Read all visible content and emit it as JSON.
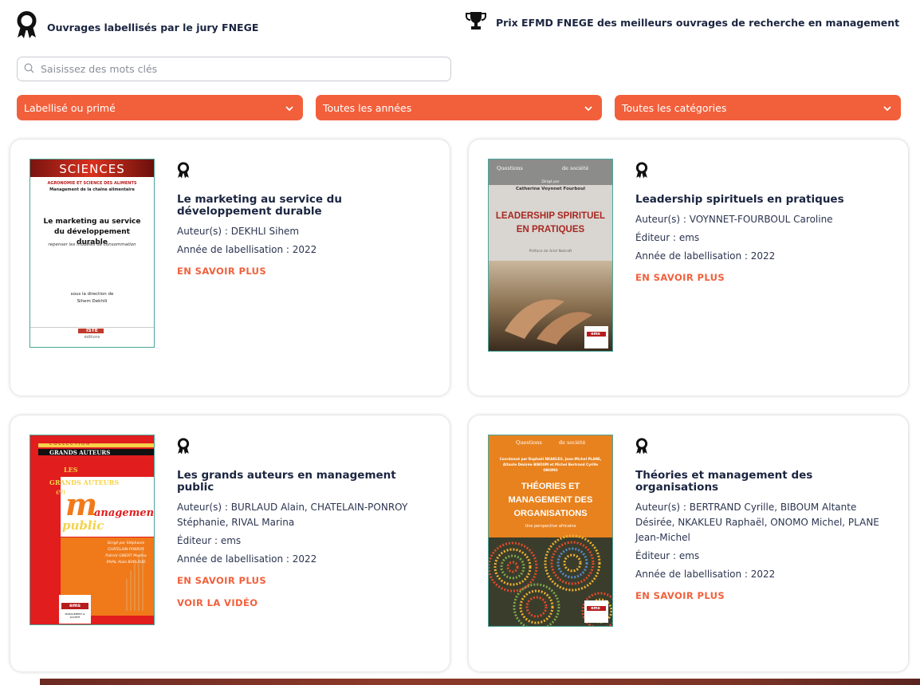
{
  "legend": {
    "labelled": "Ouvrages labellisés par le jury FNEGE",
    "prize": "Prix EFMD FNEGE des meilleurs ouvrages de recherche en management"
  },
  "search": {
    "placeholder": "Saisissez des mots clés",
    "value": ""
  },
  "filters": {
    "status": "Labellisé ou primé",
    "years": "Toutes les années",
    "categories": "Toutes les catégories"
  },
  "colors": {
    "accent": "#f2603b",
    "title": "#1b2540"
  },
  "labels": {
    "authors_prefix": "Auteur(s) : ",
    "publisher_prefix": "Éditeur : ",
    "year_prefix": "Année de labellisation : ",
    "more": "EN SAVOIR PLUS",
    "video": "VOIR LA VIDÉO"
  },
  "books": [
    {
      "title": "Le marketing au service du développement durable",
      "authors": "DEKHLI Sihem",
      "year": "2022",
      "cover": {
        "series": "SCIENCES",
        "subject": "AGRONOMIE ET SCIENCE DES ALIMENTS",
        "collection": "Management de la chaîne alimentaire",
        "title": "Le marketing au service du développement durable",
        "subtitle": "repenser les modèles de consommation",
        "direction_label": "sous la direction de",
        "direction_name": "Sihem Dekhili",
        "publisher": "ISTE",
        "publisher_sub": "éditions"
      }
    },
    {
      "title": "Leadership spirituels en pratiques",
      "authors": "VOYNNET-FOURBOUL Caroline",
      "publisher": "ems",
      "year": "2022",
      "cover": {
        "series_left": "Questions",
        "series_right": "de société",
        "director_label": "Dirigé par",
        "director": "Catherine Voynnet Fourboul",
        "title": "LEADERSHIP SPIRITUEL EN PRATIQUES",
        "preface": "Préface de Ariel Nekraft",
        "publisher": "ems"
      }
    },
    {
      "title": "Les grands auteurs en management public",
      "authors": "BURLAUD Alain, CHATELAIN-PONROY Stéphanie, RIVAL Marina",
      "publisher": "ems",
      "year": "2022",
      "cover": {
        "collection_label": "COLLECTION",
        "collection": "GRANDS AUTEURS",
        "les": "LES",
        "grands": "GRANDS AUTEURS",
        "en": "en",
        "m": "m",
        "anagement": "anagement",
        "public": "public",
        "credits": "Dirigé par Stéphanie CHATELAIN-PONROY Patrick GIBERT Madina RIVAL Alain BURLAUD",
        "publisher": "ems",
        "publisher_sub": "MANAGEMENT & SOCIÉTÉ"
      }
    },
    {
      "title": "Théories et management des organisations",
      "authors": "BERTRAND Cyrille, BIBOUM Altante Désirée, NKAKLEU Raphaël, ONOMO Michel, PLANE Jean-Michel",
      "publisher": "ems",
      "year": "2022",
      "cover": {
        "series_left": "Questions",
        "series_right": "de société",
        "coordination": "Coordonné par Raphaël NKAKLEU, Jean-Michel PLANE, Altante Désirée BIBOUM et Michel Bertrand Cyrille ONOMO",
        "title": "THÉORIES ET MANAGEMENT DES ORGANISATIONS",
        "subtitle": "Une perspective africaine",
        "publisher": "ems"
      }
    }
  ]
}
